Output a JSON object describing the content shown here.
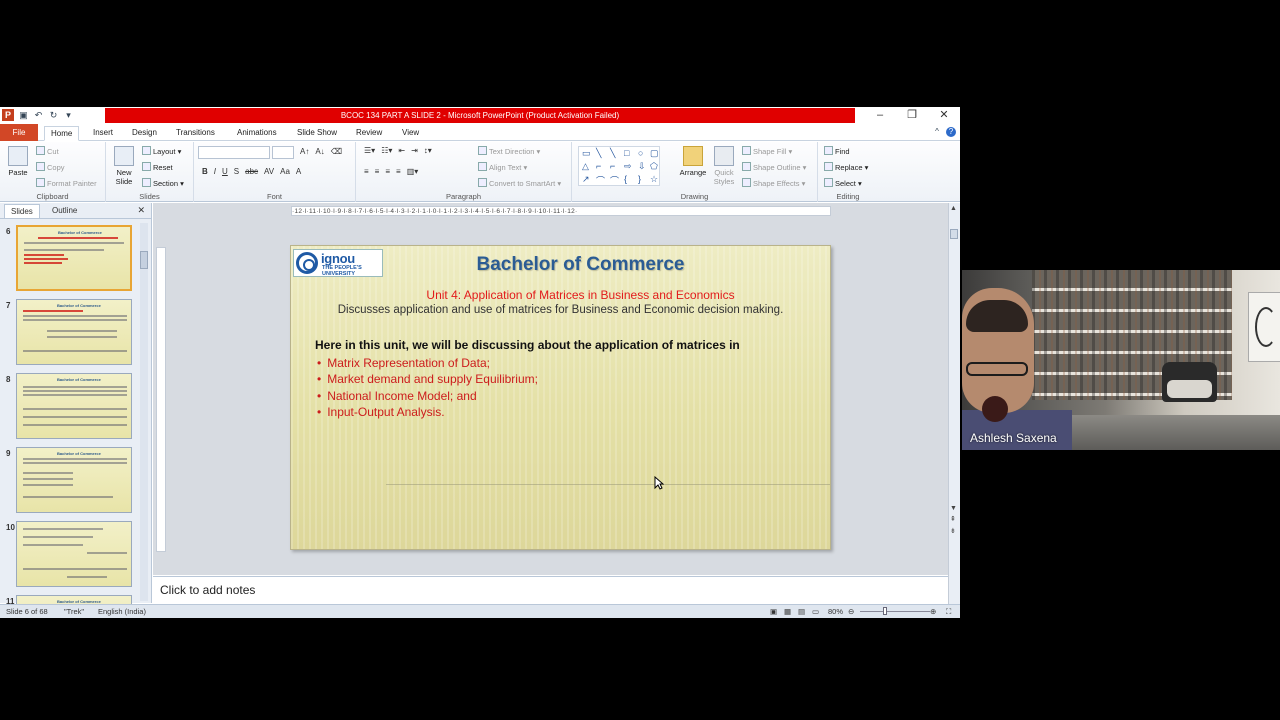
{
  "window": {
    "title": "BCOC 134 PART A SLIDE 2  -  Microsoft PowerPoint (Product Activation Failed)",
    "app_icon": "P",
    "controls": [
      "–",
      "❐",
      "✕"
    ]
  },
  "tabs": [
    "File",
    "Home",
    "Insert",
    "Design",
    "Transitions",
    "Animations",
    "Slide Show",
    "Review",
    "View"
  ],
  "ribbon": {
    "clipboard": {
      "paste": "Paste",
      "cut": "Cut",
      "copy": "Copy",
      "format_painter": "Format Painter",
      "label": "Clipboard"
    },
    "slides": {
      "new_slide": "New Slide",
      "layout": "Layout",
      "reset": "Reset",
      "section": "Section",
      "label": "Slides"
    },
    "font": {
      "bold": "B",
      "italic": "I",
      "underline": "U",
      "strike": "S",
      "shadow": "abc",
      "spacing": "AV",
      "case": "Aa",
      "color": "A",
      "label": "Font"
    },
    "paragraph": {
      "text_direction": "Text Direction",
      "align_text": "Align Text",
      "convert_smartart": "Convert to SmartArt",
      "label": "Paragraph"
    },
    "drawing": {
      "arrange": "Arrange",
      "quick_styles": "Quick Styles",
      "shape_fill": "Shape Fill",
      "shape_outline": "Shape Outline",
      "shape_effects": "Shape Effects",
      "label": "Drawing"
    },
    "editing": {
      "find": "Find",
      "replace": "Replace",
      "select": "Select",
      "label": "Editing"
    }
  },
  "left_pane": {
    "tab_slides": "Slides",
    "tab_outline": "Outline",
    "close": "✕",
    "thumbnails": [
      "6",
      "7",
      "8",
      "9",
      "10",
      "11"
    ]
  },
  "ruler": "·12·l·11·l·10·l·9·l·8·l·7·l·6·l·5·l·4·l·3·l·2·l·1·l·0·l·1·l·2·l·3·l·4·l·5·l·6·l·7·l·8·l·9·l·10·l·11·l·12·",
  "slide": {
    "logo_main": "ignou",
    "logo_sub_1": "THE PEOPLE'S",
    "logo_sub_2": "UNIVERSITY",
    "title": "Bachelor of Commerce",
    "unit": "Unit 4: Application of Matrices in Business and Economics",
    "description": "Discusses application and use of matrices for Business and Economic decision making.",
    "intro": "Here in this unit, we will be discussing about the application of matrices in",
    "bullets": [
      "Matrix Representation of Data;",
      "Market demand and supply Equilibrium;",
      "National Income Model; and",
      "Input-Output Analysis."
    ]
  },
  "notes_placeholder": "Click to add notes",
  "status": {
    "slide_count": "Slide 6 of 68",
    "theme": "\"Trek\"",
    "language": "English (India)",
    "zoom": "80%"
  },
  "video": {
    "caller_name": "Ashlesh Saxena"
  }
}
